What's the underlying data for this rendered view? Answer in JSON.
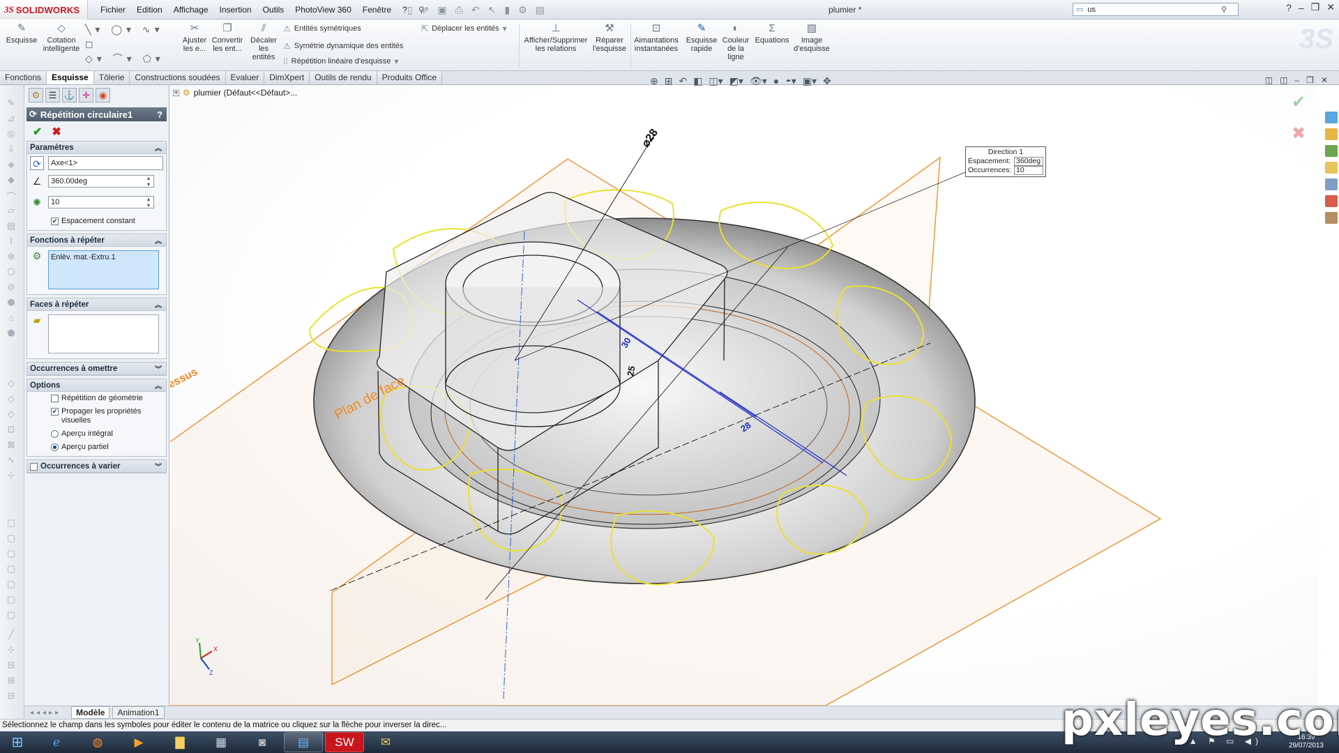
{
  "app": {
    "brand_symbol": "3S",
    "brand_name": "SOLIDWORKS",
    "document_title": "plumier *",
    "menu": [
      "Fichier",
      "Edition",
      "Affichage",
      "Insertion",
      "Outils",
      "PhotoView 360",
      "Fenêtre",
      "?"
    ],
    "search_value": "us"
  },
  "toolbar": {
    "esquisse": "Esquisse",
    "cotation": "Cotation intelligente",
    "ajuster": "Ajuster les e...",
    "convertir": "Convertir les ent...",
    "decaler": "Décaler les entités",
    "entites_sym": "Entités symétriques",
    "sym_dyn": "Symétrie dynamique des entités",
    "rep_lin": "Répétition linéaire d'esquisse",
    "deplacer": "Déplacer les entités",
    "afficher_rel": "Afficher/Supprimer les relations",
    "reparer": "Réparer l'esquisse",
    "aimantations": "Aimantations instantanées",
    "esquisse_rapide": "Esquisse rapide",
    "couleur": "Couleur de la ligne",
    "equations": "Equations",
    "image": "Image d'esquisse"
  },
  "tabs": [
    "Fonctions",
    "Esquisse",
    "Tôlerie",
    "Constructions soudées",
    "Evaluer",
    "DimXpert",
    "Outils de rendu",
    "Produits Office"
  ],
  "active_tab_index": 1,
  "tree": {
    "root": "plumier  (Défaut<<Défaut>..."
  },
  "pm": {
    "title": "Répétition circulaire1",
    "help": "?",
    "ok_label": "✔",
    "cancel_label": "✖",
    "params_title": "Paramètres",
    "axis_value": "Axe<1>",
    "angle_value": "360.00deg",
    "count_value": "10",
    "espacement_label": "Espacement constant",
    "fonctions_title": "Fonctions à répéter",
    "fonctions_item": "Enlèv. mat.-Extru.1",
    "faces_title": "Faces à répéter",
    "omettre_title": "Occurrences à omettre",
    "options_title": "Options",
    "opt_geom": "Répétition de géométrie",
    "opt_prop": "Propager les propriétés visuelles",
    "opt_integral": "Aperçu intégral",
    "opt_partiel": "Aperçu partiel",
    "varier_title": "Occurrences à varier"
  },
  "callout": {
    "header": "Direction 1",
    "spacing_label": "Espacement:",
    "spacing_value": "360deg",
    "count_label": "Occurrences:",
    "count_value": "10"
  },
  "model_labels": {
    "plane": "Plan de face",
    "plane2": "essus",
    "dia": "⌀28",
    "d1": "30",
    "d2": "25",
    "d3": "28"
  },
  "triad": {
    "x": "X",
    "y": "Y",
    "z": "Z"
  },
  "bottom_tabs": [
    "Modèle",
    "Animation1"
  ],
  "status_text": "Sélectionnez le champ dans les symboles pour éditer le contenu de la matrice ou cliquez sur la flèche pour inverser la direc...",
  "clock": {
    "time": "16:39",
    "date": "29/07/2013"
  },
  "watermark": "pxleyes.com",
  "colors": {
    "accent": "#1e58a8",
    "sketch_yellow": "#e8e233",
    "plane_orange": "#f08a24",
    "dimension_blue": "#1b2bc9"
  }
}
